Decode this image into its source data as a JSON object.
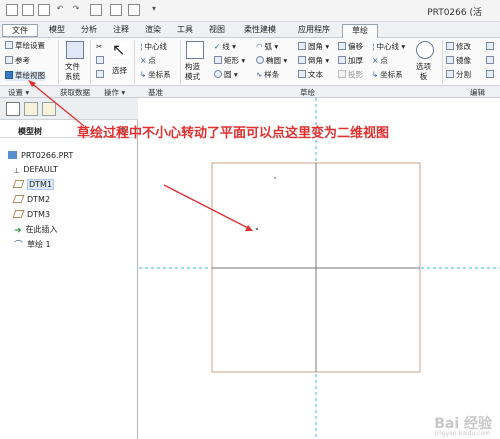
{
  "window": {
    "title": "PRT0266 (活"
  },
  "tabs": [
    {
      "label": "文件"
    },
    {
      "label": "模型"
    },
    {
      "label": "分析"
    },
    {
      "label": "注释"
    },
    {
      "label": "渲染"
    },
    {
      "label": "工具"
    },
    {
      "label": "视图"
    },
    {
      "label": "柔性建模"
    },
    {
      "label": "应用程序"
    },
    {
      "label": "草绘"
    }
  ],
  "ribbon": {
    "setup": {
      "sketch_setup": "草绘设置",
      "reference": "参考",
      "sketch_view": "草绘视图"
    },
    "file_system": "文件\n系统",
    "select": "选择",
    "centerline": "中心线",
    "point": "点",
    "coordinate_system": "坐标系",
    "construction_mode": "构造\n模式",
    "line": "线",
    "rectangle": "矩形",
    "circle": "圆",
    "arc": "弧",
    "ellipse": "椭圆",
    "spline": "样条",
    "fillet": "圆角",
    "chamfer": "倒角",
    "text": "文本",
    "offset": "偏移",
    "thicken": "加厚",
    "project": "投影",
    "centerline2": "中心线",
    "point2": "点",
    "coordsys2": "坐标系",
    "palette": "选项\n板",
    "modify": "修改",
    "mirror": "镜像",
    "divide": "分割"
  },
  "groups": {
    "setup": "设置",
    "get_data": "获取数据",
    "operations": "操作",
    "datum": "基准",
    "sketching": "草绘",
    "editing": "编辑"
  },
  "tree": {
    "title": "模型树",
    "items": [
      {
        "label": "PRT0266.PRT"
      },
      {
        "label": "DEFAULT"
      },
      {
        "label": "DTM1"
      },
      {
        "label": "DTM2"
      },
      {
        "label": "DTM3"
      },
      {
        "label": "在此插入"
      },
      {
        "label": "草绘 1"
      }
    ]
  },
  "annotation": {
    "text": "草绘过程中不小心转动了平面可以点这里变为二维视图"
  },
  "watermark": {
    "text": "Bai 经验",
    "sub": "jingyan.baidu.com"
  },
  "colors": {
    "annotation": "#e03030",
    "datum_cyan": "#39b9d6",
    "sketch_edge": "#c9a58a"
  }
}
